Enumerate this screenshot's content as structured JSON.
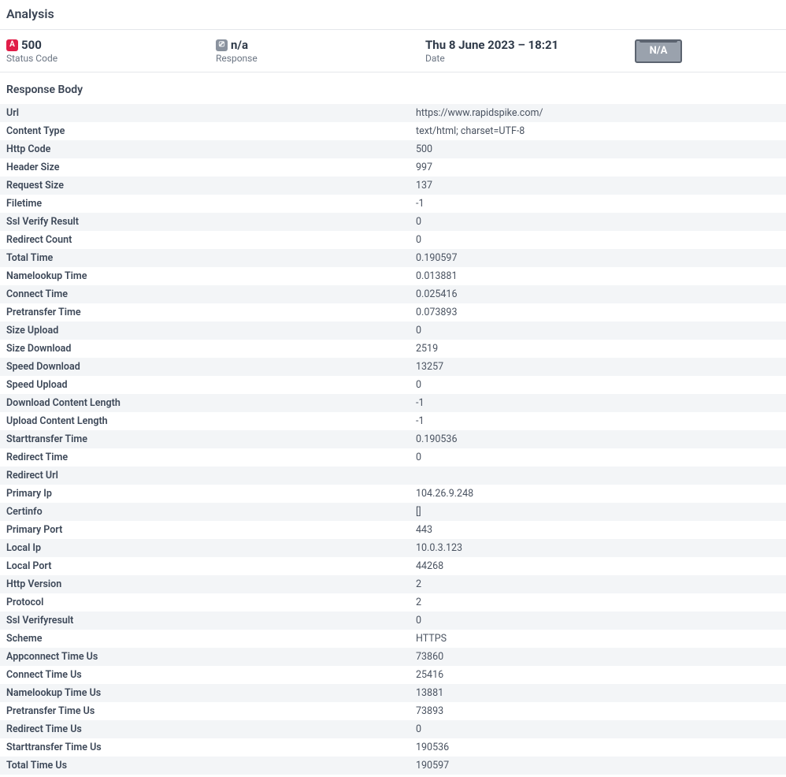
{
  "title": "Analysis",
  "summary": {
    "statusCode": {
      "value": "500",
      "label": "Status Code",
      "badge": "A"
    },
    "response": {
      "value": "n/a",
      "label": "Response",
      "badge": "⎚"
    },
    "date": {
      "value": "Thu 8 June 2023 – 18:21",
      "label": "Date"
    },
    "na": "N/A"
  },
  "responseBody": {
    "heading": "Response Body",
    "rows": [
      {
        "key": "Url",
        "value": "https://www.rapidspike.com/"
      },
      {
        "key": "Content Type",
        "value": "text/html; charset=UTF-8"
      },
      {
        "key": "Http Code",
        "value": "500"
      },
      {
        "key": "Header Size",
        "value": "997"
      },
      {
        "key": "Request Size",
        "value": "137"
      },
      {
        "key": "Filetime",
        "value": "-1"
      },
      {
        "key": "Ssl Verify Result",
        "value": "0"
      },
      {
        "key": "Redirect Count",
        "value": "0"
      },
      {
        "key": "Total Time",
        "value": "0.190597"
      },
      {
        "key": "Namelookup Time",
        "value": "0.013881"
      },
      {
        "key": "Connect Time",
        "value": "0.025416"
      },
      {
        "key": "Pretransfer Time",
        "value": "0.073893"
      },
      {
        "key": "Size Upload",
        "value": "0"
      },
      {
        "key": "Size Download",
        "value": "2519"
      },
      {
        "key": "Speed Download",
        "value": "13257"
      },
      {
        "key": "Speed Upload",
        "value": "0"
      },
      {
        "key": "Download Content Length",
        "value": "-1"
      },
      {
        "key": "Upload Content Length",
        "value": "-1"
      },
      {
        "key": "Starttransfer Time",
        "value": "0.190536"
      },
      {
        "key": "Redirect Time",
        "value": "0"
      },
      {
        "key": "Redirect Url",
        "value": ""
      },
      {
        "key": "Primary Ip",
        "value": "104.26.9.248"
      },
      {
        "key": "Certinfo",
        "value": "[]"
      },
      {
        "key": "Primary Port",
        "value": "443"
      },
      {
        "key": "Local Ip",
        "value": "10.0.3.123"
      },
      {
        "key": "Local Port",
        "value": "44268"
      },
      {
        "key": "Http Version",
        "value": "2"
      },
      {
        "key": "Protocol",
        "value": "2"
      },
      {
        "key": "Ssl Verifyresult",
        "value": "0"
      },
      {
        "key": "Scheme",
        "value": "HTTPS"
      },
      {
        "key": "Appconnect Time Us",
        "value": "73860"
      },
      {
        "key": "Connect Time Us",
        "value": "25416"
      },
      {
        "key": "Namelookup Time Us",
        "value": "13881"
      },
      {
        "key": "Pretransfer Time Us",
        "value": "73893"
      },
      {
        "key": "Redirect Time Us",
        "value": "0"
      },
      {
        "key": "Starttransfer Time Us",
        "value": "190536"
      },
      {
        "key": "Total Time Us",
        "value": "190597"
      }
    ]
  }
}
